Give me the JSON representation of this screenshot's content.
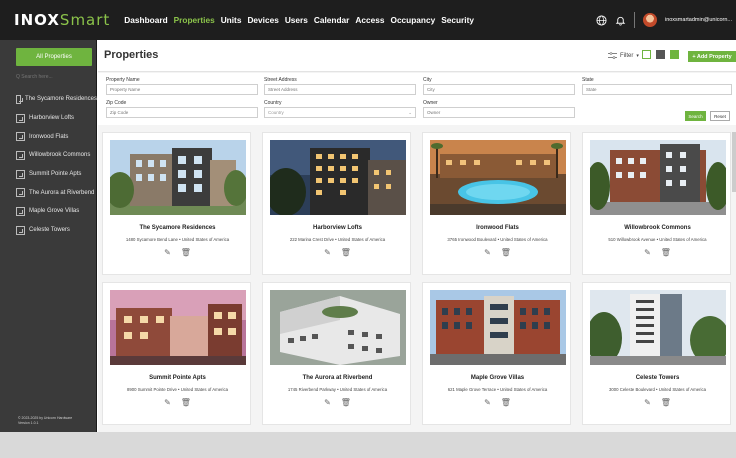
{
  "app": {
    "logo_main": "INOX",
    "logo_accent": "Smart"
  },
  "nav": [
    "Dashboard",
    "Properties",
    "Units",
    "Devices",
    "Users",
    "Calendar",
    "Access",
    "Occupancy",
    "Security"
  ],
  "nav_active": "Properties",
  "user": {
    "email": "inoxsmartadmin@unicorn..."
  },
  "sidebar": {
    "all_properties": "All Properties",
    "search_placeholder": "Q Search here...",
    "items": [
      "The Sycamore Residences",
      "Harborview Lofts",
      "Ironwood Flats",
      "Willowbrook Commons",
      "Summit Pointe Apts",
      "The Aurora at Riverbend",
      "Maple Grove Villas",
      "Celeste Towers"
    ],
    "copyright": "© 2023-2025 by Unicorn Hardware",
    "version": "Version 1.0.1"
  },
  "page": {
    "title": "Properties",
    "filter_label": "Filter",
    "add_button": "+ Add Property"
  },
  "filters": {
    "property_name_label": "Property Name",
    "property_name_placeholder": "Property Name",
    "street_label": "Street Address",
    "street_placeholder": "Street Address",
    "city_label": "City",
    "city_placeholder": "City",
    "state_label": "State",
    "state_placeholder": "State",
    "zip_label": "Zip Code",
    "zip_placeholder": "Zip Code",
    "country_label": "Country",
    "country_value": "Country",
    "owner_label": "Owner",
    "owner_placeholder": "Owner",
    "search_button": "Search",
    "reset_button": "Reset"
  },
  "properties": [
    {
      "name": "The Sycamore Residences",
      "address": "1480 Sycamore Bend Lane • United States of America"
    },
    {
      "name": "Harborview Lofts",
      "address": "222 Marina Crest Drive • United States of America"
    },
    {
      "name": "Ironwood Flats",
      "address": "3765 Ironwood Boulevard • United States of America"
    },
    {
      "name": "Willowbrook Commons",
      "address": "510 Willowbrook Avenue • United States of America"
    },
    {
      "name": "Summit Pointe Apts",
      "address": "8900 Summit Pointe Drive • United States of America"
    },
    {
      "name": "The Aurora at Riverbend",
      "address": "1745 Riverbend Parkway • United States of America"
    },
    {
      "name": "Maple Grove Villas",
      "address": "621 Maple Grove Terrace • United States of America"
    },
    {
      "name": "Celeste Towers",
      "address": "3000 Celeste Boulevard • United States of America"
    }
  ],
  "colors": {
    "accent": "#6fb43f",
    "topbar": "#1e1e1e",
    "sidebar": "#3a3a3a"
  }
}
